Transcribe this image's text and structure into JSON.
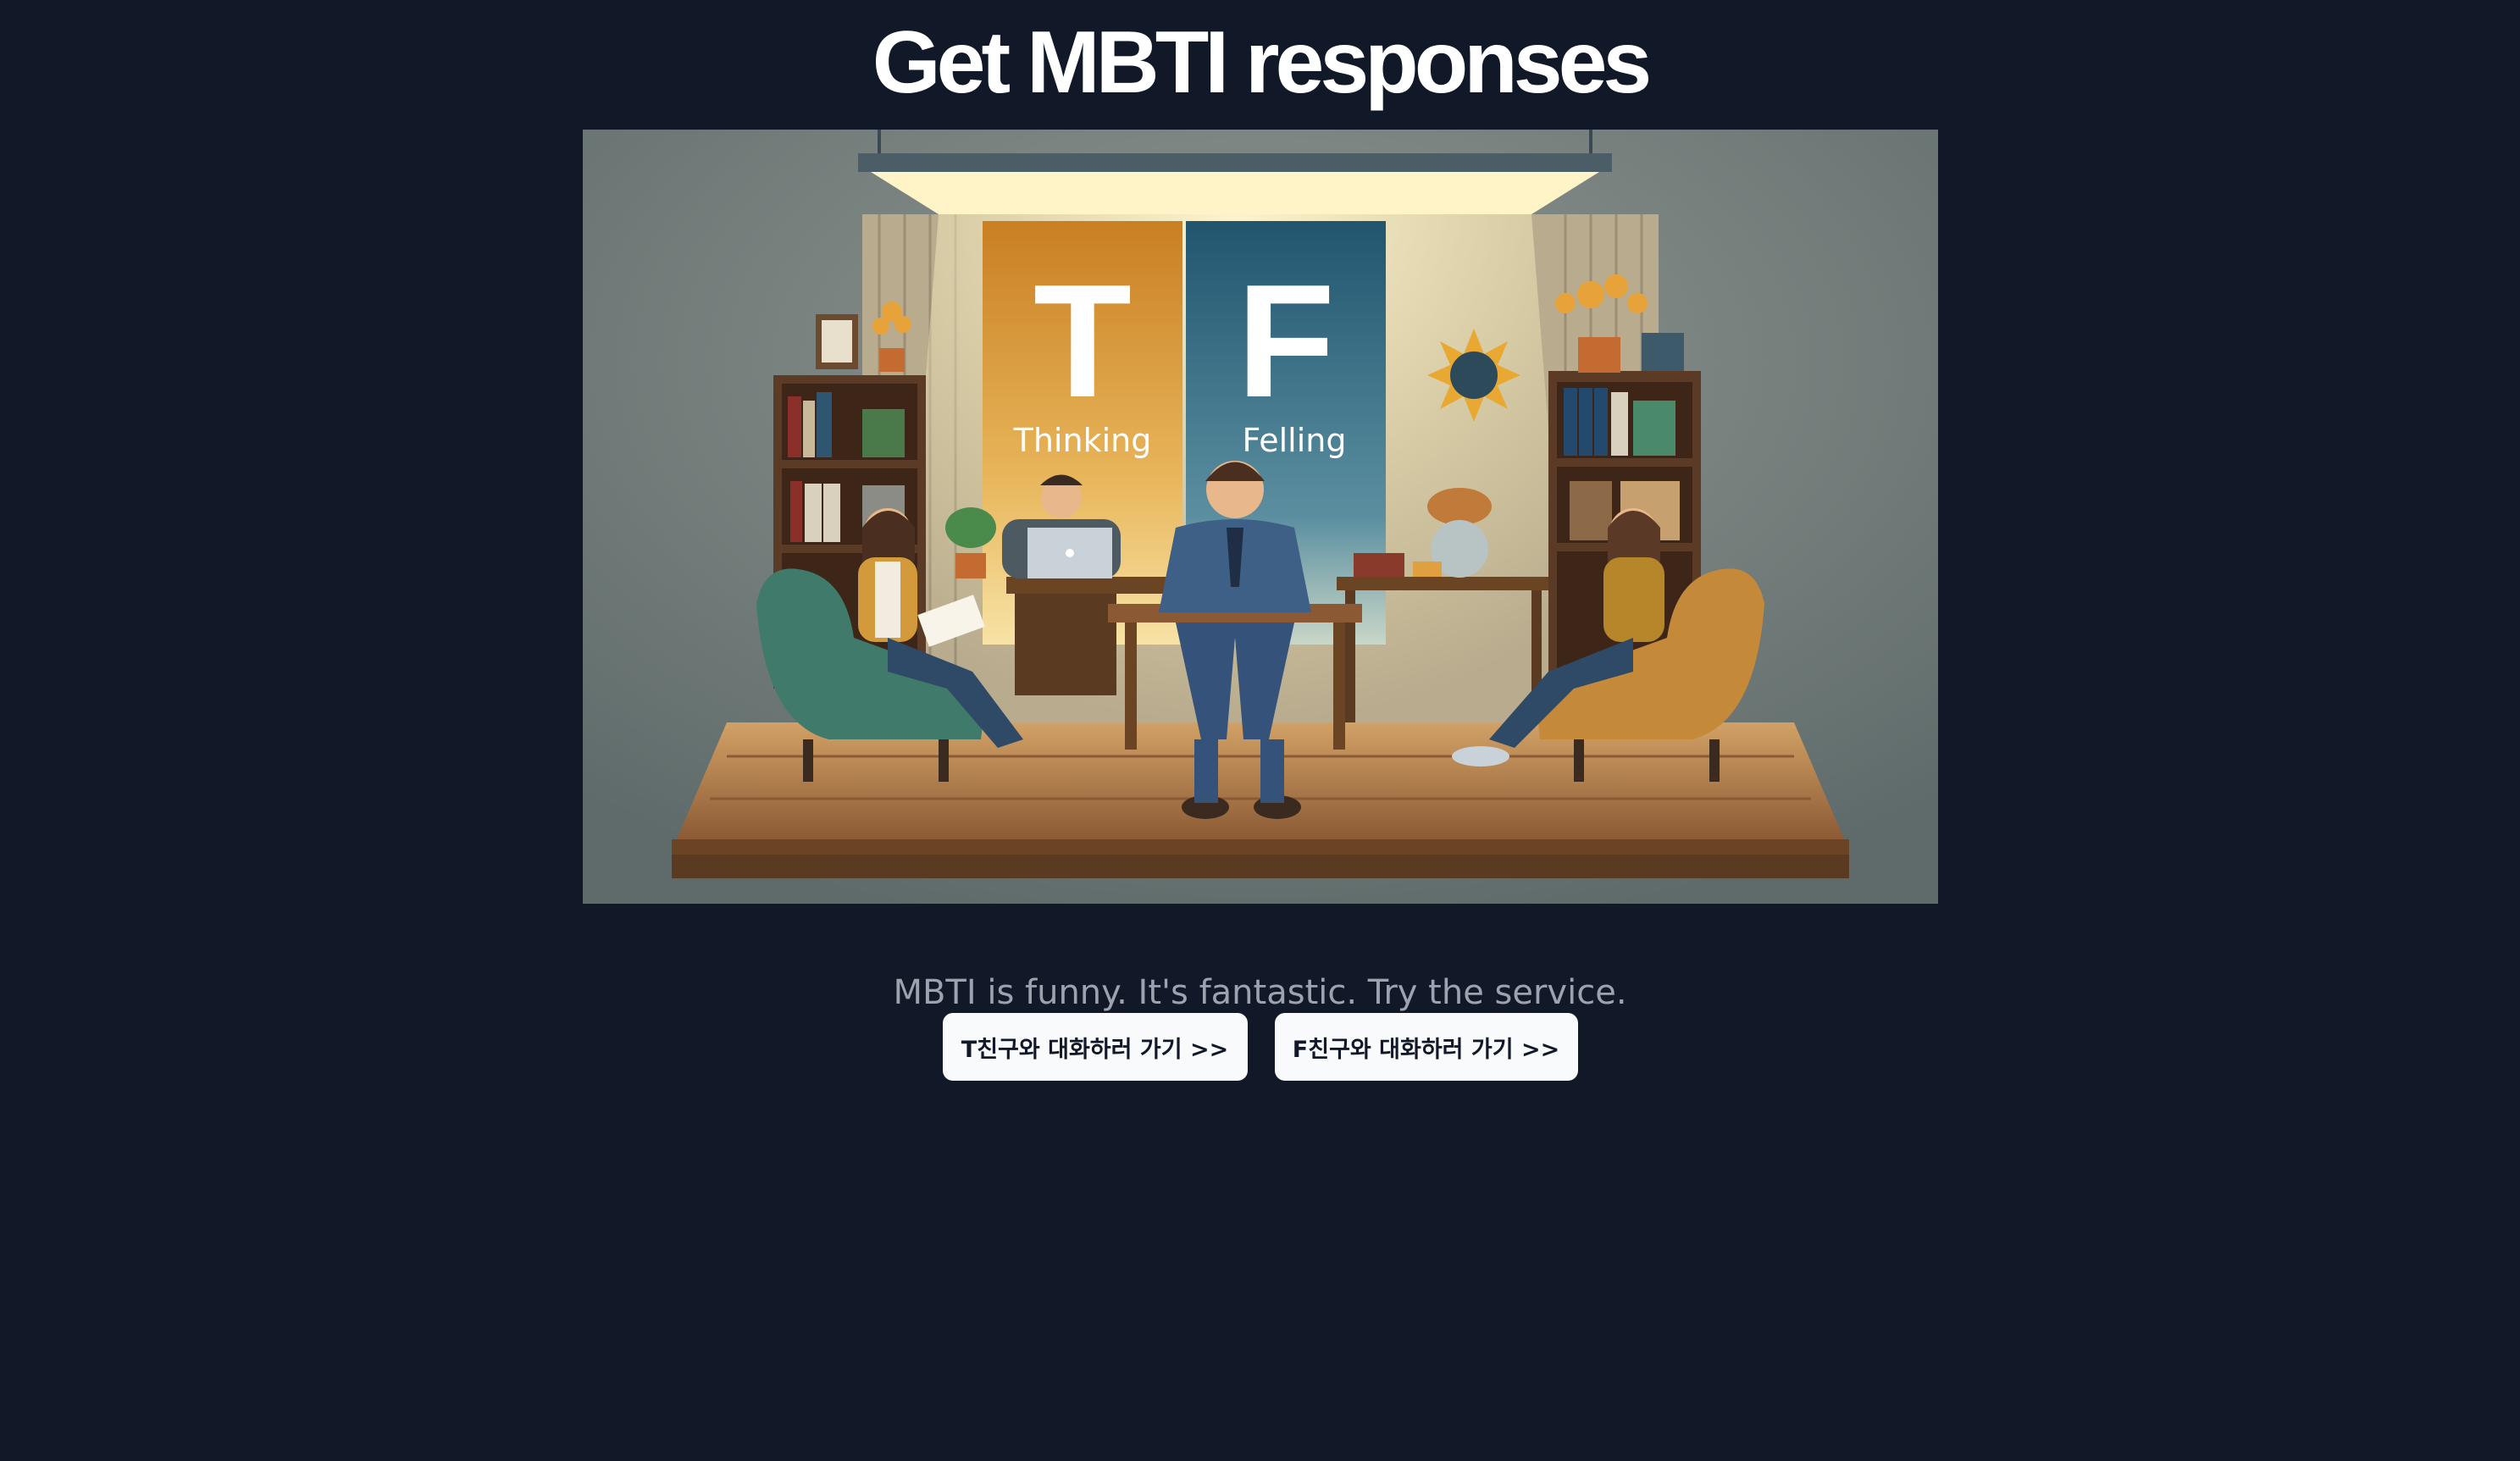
{
  "page": {
    "title": "Get MBTI responses",
    "tagline": "MBTI is funny. It's fantastic. Try the service."
  },
  "hero": {
    "banner_t_letter": "T",
    "banner_t_word": "Thinking",
    "banner_f_letter": "F",
    "banner_f_word": "Felling",
    "colors": {
      "thinking": "#d8922a",
      "feeling": "#2f6b86",
      "background": "#6f7a78"
    }
  },
  "actions": {
    "t_friend_button": "T친구와 대화하러 가기 >>",
    "f_friend_button": "F친구와 대화하러 가기 >>"
  },
  "theme": {
    "background": "#111827",
    "button_bg": "#f9fafb",
    "tagline_color": "#9ca3af"
  }
}
